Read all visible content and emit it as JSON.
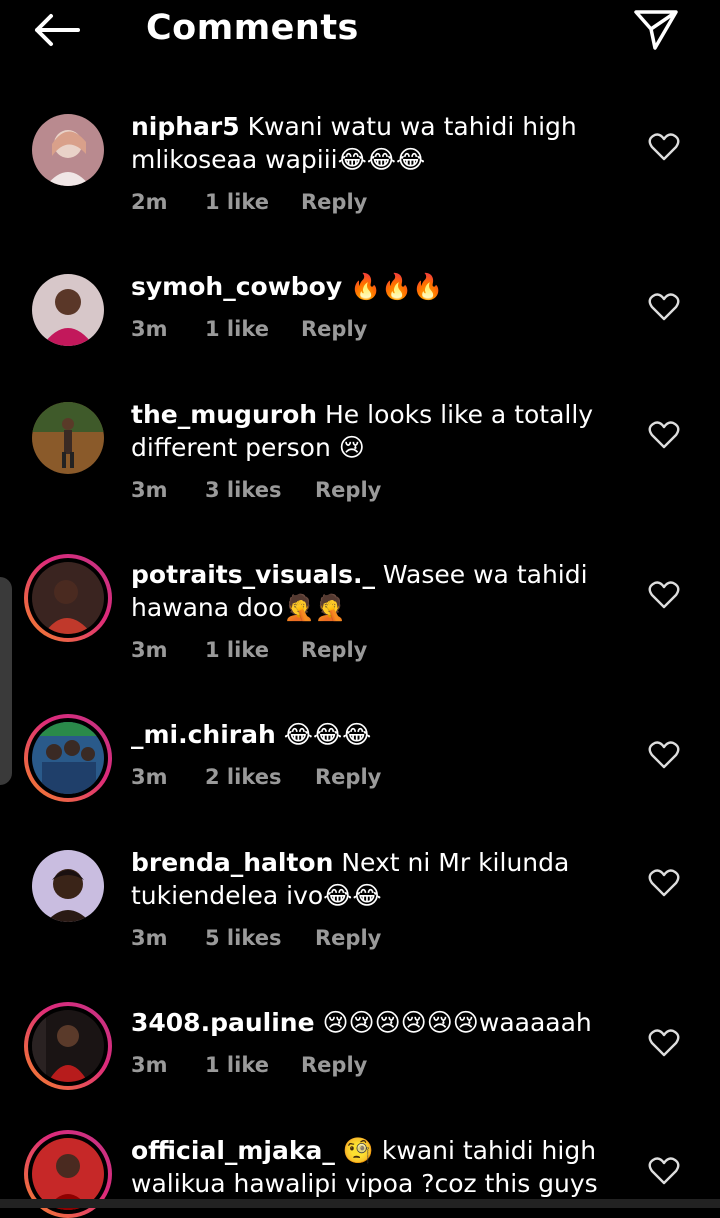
{
  "header": {
    "title": "Comments",
    "back_icon": "arrow-left-icon",
    "send_icon": "paper-plane-icon"
  },
  "comments": [
    {
      "username": "niphar5",
      "text": " Kwani watu wa tahidi high mlikoseaa wapiii😂😂😂",
      "time": "2m",
      "likes": "1 like",
      "reply": "Reply"
    },
    {
      "username": "symoh_cowboy",
      "text": " 🔥🔥🔥",
      "time": "3m",
      "likes": "1 like",
      "reply": "Reply"
    },
    {
      "username": "the_muguroh",
      "text": " He looks like a totally different person 😢",
      "time": "3m",
      "likes": "3 likes",
      "reply": "Reply"
    },
    {
      "username": "potraits_visuals._",
      "text": " Wasee wa tahidi hawana doo🤦🤦",
      "time": "3m",
      "likes": "1 like",
      "reply": "Reply"
    },
    {
      "username": "_mi.chirah",
      "text": " 😂😂😂",
      "time": "3m",
      "likes": "2 likes",
      "reply": "Reply"
    },
    {
      "username": "brenda_halton",
      "text": " Next ni Mr kilunda tukiendelea ivo😂😂",
      "time": "3m",
      "likes": "5 likes",
      "reply": "Reply"
    },
    {
      "username": "3408.pauline",
      "text": " 😢😢😢😢😢😢waaaaah",
      "time": "3m",
      "likes": "1 like",
      "reply": "Reply"
    },
    {
      "username": "official_mjaka_",
      "text": " 🧐 kwani tahidi high walikua hawalipi vipoa ?coz this guys",
      "time": "",
      "likes": "",
      "reply": ""
    }
  ],
  "colors": {
    "background": "#000000",
    "text": "#ffffff",
    "meta": "#9a9a9a",
    "ring_start": "#f58529",
    "ring_end": "#c13584"
  },
  "icons": {
    "like": "heart-outline-icon"
  }
}
